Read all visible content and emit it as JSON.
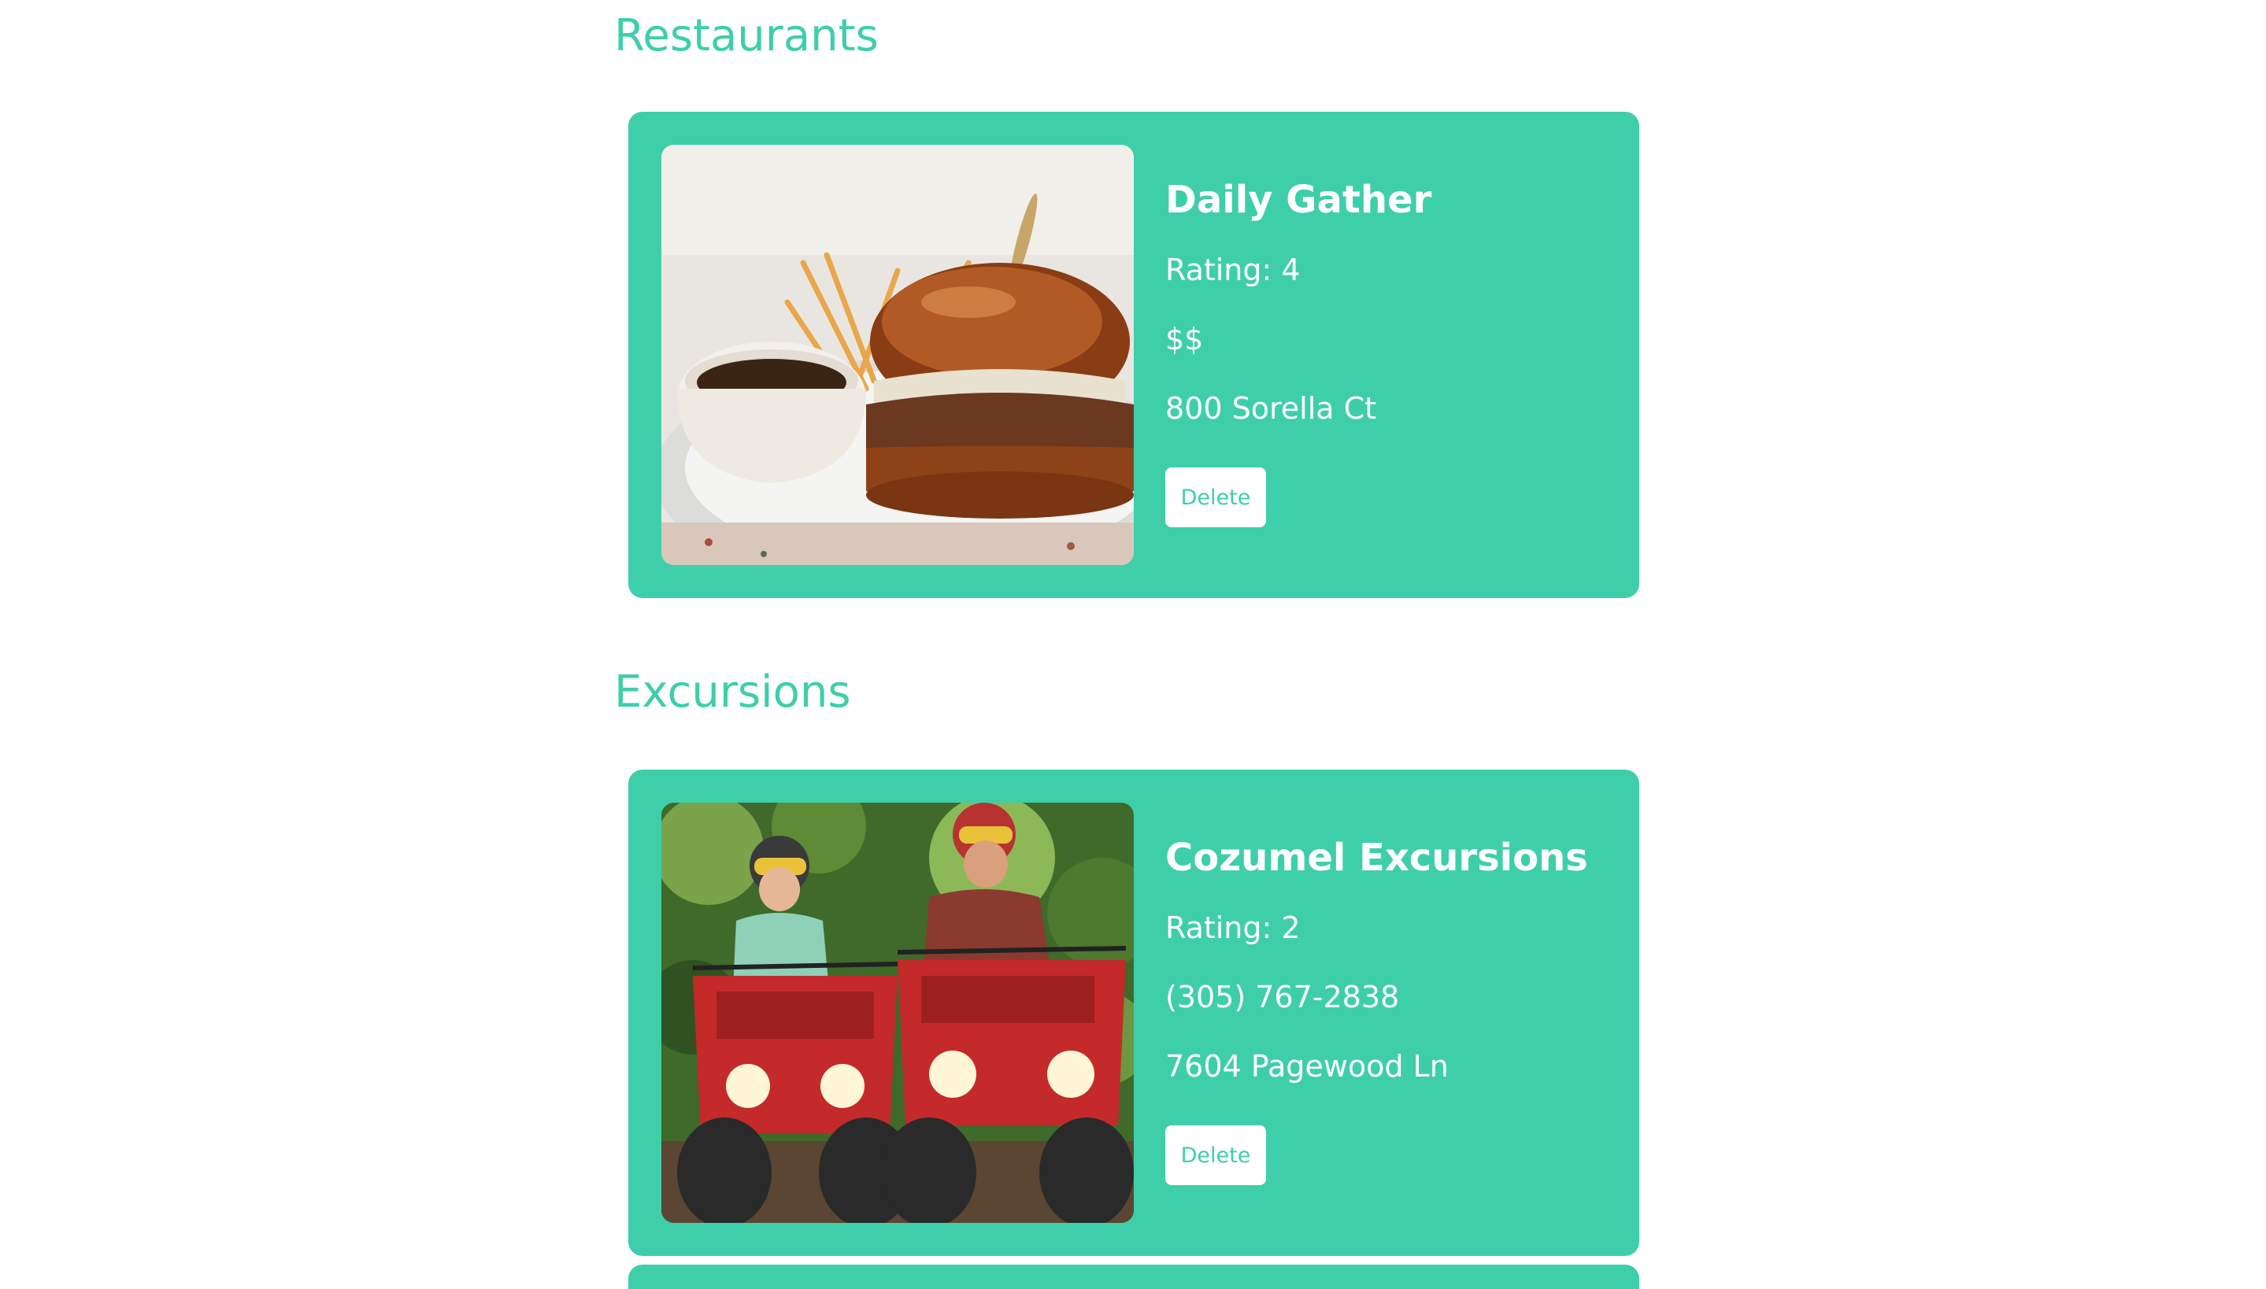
{
  "sections": {
    "restaurants": {
      "title": "Restaurants",
      "card": {
        "name": "Daily Gather",
        "rating": "Rating: 4",
        "price": "$$",
        "address": "800 Sorella Ct",
        "delete_label": "Delete"
      }
    },
    "excursions": {
      "title": "Excursions",
      "card": {
        "name": "Cozumel Excursions",
        "rating": "Rating: 2",
        "phone": "(305) 767-2838",
        "address": "7604 Pagewood Ln",
        "delete_label": "Delete"
      }
    }
  },
  "colors": {
    "accent": "#3ecfaa",
    "card_text": "#ffffff",
    "button_bg": "#ffffff"
  },
  "images": {
    "restaurant": "sandwich-photo",
    "excursion": "atv-riders-photo"
  }
}
